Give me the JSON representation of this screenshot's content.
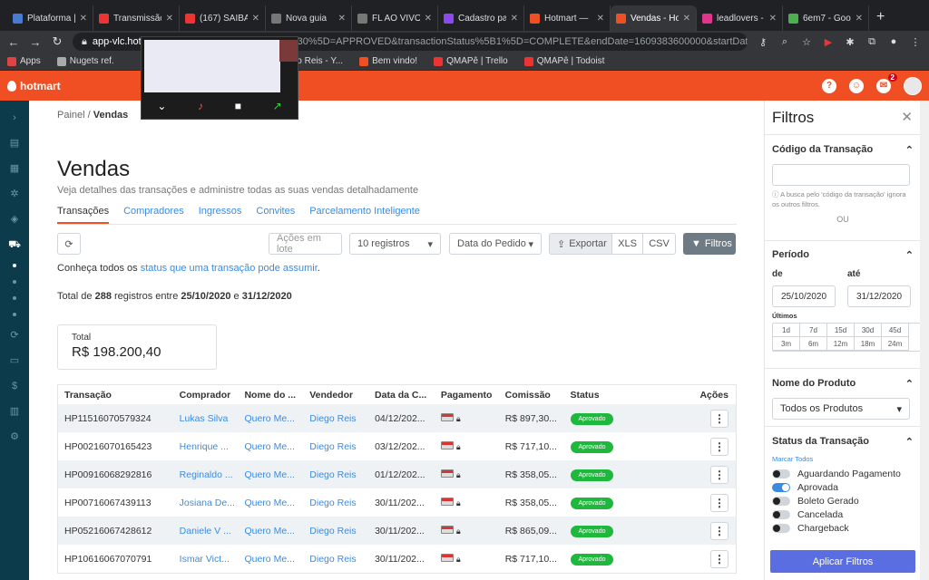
{
  "browser": {
    "tabs": [
      {
        "title": "Plataforma |",
        "color": "#4a7bd0"
      },
      {
        "title": "Transmissão",
        "color": "#e33"
      },
      {
        "title": "(167) SAIBA",
        "color": "#e33"
      },
      {
        "title": "Nova guia",
        "color": "#777"
      },
      {
        "title": "FL AO VIVO",
        "color": "#777"
      },
      {
        "title": "Cadastro pa",
        "color": "#8a4af0"
      },
      {
        "title": "Hotmart — ",
        "color": "#f04e23"
      },
      {
        "title": "Vendas - Ho",
        "color": "#f04e23",
        "active": true
      },
      {
        "title": "leadlovers -",
        "color": "#e0358a"
      },
      {
        "title": "6em7 - Goo",
        "color": "#4caf50"
      }
    ],
    "url_host": "app-vlc.hot",
    "url_rest": "30%5D=APPROVED&transactionStatus%5B1%5D=COMPLETE&endDate=1609383600000&startDate...",
    "bookmarks": [
      "Apps",
      "Nugets ref.",
      "(1) Diego Reis - Y...",
      "Bem vindo!",
      "QMAPê | Trello",
      "QMAPê | Todoist"
    ]
  },
  "header": {
    "logo": "hotmart",
    "notif_count": "2"
  },
  "breadcrumb": {
    "root": "Painel",
    "sep": "/",
    "current": "Vendas"
  },
  "page": {
    "title": "Vendas",
    "subtitle": "Veja detalhes das transações e administre todas as suas vendas detalhadamente",
    "tabs": [
      "Transações",
      "Compradores",
      "Ingressos",
      "Convites",
      "Parcelamento Inteligente"
    ]
  },
  "actions": {
    "bulk": "Ações em lote",
    "page_size": "10 registros",
    "sort": "Data do Pedido",
    "export": "Exportar",
    "xls": "XLS",
    "csv": "CSV",
    "filters": "Filtros"
  },
  "info": {
    "prefix": "Conheça todos os",
    "link": "status que uma transação pode assumir",
    "suffix": "."
  },
  "totals": {
    "line_prefix": "Total de",
    "count": "288",
    "line_mid": "registros entre",
    "start": "25/10/2020",
    "and": "e",
    "end": "31/12/2020",
    "card_label": "Total",
    "card_value": "R$ 198.200,40"
  },
  "table": {
    "headers": [
      "Transação",
      "Comprador",
      "Nome do ...",
      "Vendedor",
      "Data da C...",
      "Pagamento",
      "Comissão",
      "Status",
      "Ações"
    ],
    "rows": [
      {
        "id": "HP11516070579324",
        "buyer": "Lukas Silva",
        "product": "Quero Me...",
        "seller": "Diego Reis",
        "date": "04/12/202...",
        "commission": "R$ 897,30...",
        "status": "Aprovado"
      },
      {
        "id": "HP00216070165423",
        "buyer": "Henrique ...",
        "product": "Quero Me...",
        "seller": "Diego Reis",
        "date": "03/12/202...",
        "commission": "R$ 717,10...",
        "status": "Aprovado"
      },
      {
        "id": "HP00916068292816",
        "buyer": "Reginaldo ...",
        "product": "Quero Me...",
        "seller": "Diego Reis",
        "date": "01/12/202...",
        "commission": "R$ 358,05...",
        "status": "Aprovado"
      },
      {
        "id": "HP00716067439113",
        "buyer": "Josiana De...",
        "product": "Quero Me...",
        "seller": "Diego Reis",
        "date": "30/11/202...",
        "commission": "R$ 358,05...",
        "status": "Aprovado"
      },
      {
        "id": "HP05216067428612",
        "buyer": "Daniele V ...",
        "product": "Quero Me...",
        "seller": "Diego Reis",
        "date": "30/11/202...",
        "commission": "R$ 865,09...",
        "status": "Aprovado"
      },
      {
        "id": "HP10616067070791",
        "buyer": "Ismar Vict...",
        "product": "Quero Me...",
        "seller": "Diego Reis",
        "date": "30/11/202...",
        "commission": "R$ 717,10...",
        "status": "Aprovado"
      }
    ]
  },
  "filters": {
    "title": "Filtros",
    "code_title": "Código da Transação",
    "code_value": "",
    "code_note": "A busca pelo 'código da transação' ignora os outros filtros.",
    "or": "OU",
    "period_title": "Período",
    "from_label": "de",
    "to_label": "até",
    "from_value": "25/10/2020",
    "to_value": "31/12/2020",
    "recent_label": "Últimos",
    "recent": [
      "1d",
      "7d",
      "15d",
      "30d",
      "45d",
      "3m",
      "6m",
      "12m",
      "18m",
      "24m"
    ],
    "product_title": "Nome do Produto",
    "product_value": "Todos os Produtos",
    "status_title": "Status da Transação",
    "mark_all": "Marcar Todos",
    "statuses": [
      {
        "label": "Aguardando Pagamento",
        "on": false
      },
      {
        "label": "Aprovada",
        "on": true
      },
      {
        "label": "Boleto Gerado",
        "on": false
      },
      {
        "label": "Cancelada",
        "on": false
      },
      {
        "label": "Chargeback",
        "on": false
      }
    ],
    "apply": "Aplicar Filtros"
  }
}
